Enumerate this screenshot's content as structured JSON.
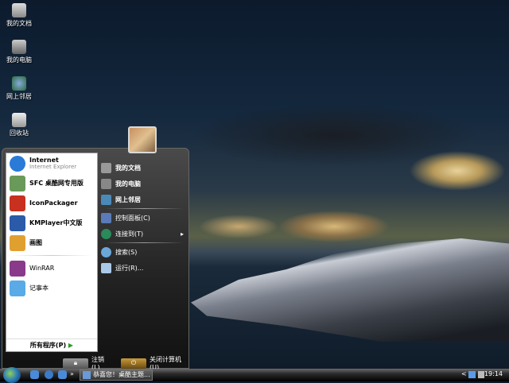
{
  "desktop_icons": [
    {
      "label": "我的文档",
      "icon": "documents-icon"
    },
    {
      "label": "我的电脑",
      "icon": "computer-icon"
    },
    {
      "label": "网上邻居",
      "icon": "network-icon"
    },
    {
      "label": "回收站",
      "icon": "recycle-bin-icon"
    }
  ],
  "start_menu": {
    "pinned": [
      {
        "label": "Internet",
        "sub": "Internet Explorer",
        "color": "#2a7ad8"
      },
      {
        "label": "SFC 桌酷网专用版",
        "color": "#6a9a5a"
      },
      {
        "label": "IconPackager",
        "color": "#c83020"
      },
      {
        "label": "KMPlayer中文版",
        "color": "#2a5aa8"
      },
      {
        "label": "画图",
        "color": "#e0a030"
      }
    ],
    "recent": [
      {
        "label": "WinRAR",
        "color": "#8a3a8a"
      },
      {
        "label": "记事本",
        "color": "#5aaae8"
      }
    ],
    "all_programs": "所有程序(P)",
    "right_items": [
      {
        "label": "我的文档",
        "bold": true
      },
      {
        "label": "我的电脑",
        "bold": true
      },
      {
        "label": "网上邻居",
        "bold": true
      },
      {
        "label": "控制面板(C)"
      },
      {
        "label": "连接到(T)",
        "arrow": "▸"
      },
      {
        "label": "搜索(S)"
      },
      {
        "label": "运行(R)..."
      }
    ],
    "logoff": "注销(L)",
    "shutdown": "关闭计算机(U)"
  },
  "taskbar": {
    "task_label": "恭喜您！桌酷主题...",
    "overflow": "»",
    "tray_arrow": "<",
    "clock": "19:14"
  }
}
